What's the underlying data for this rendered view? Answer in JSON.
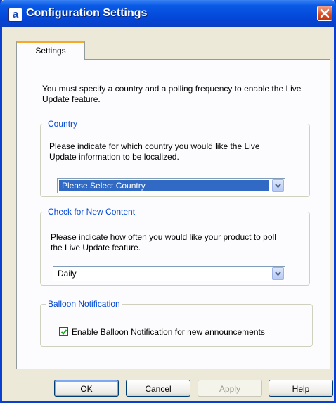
{
  "window": {
    "title": "Configuration Settings",
    "app_icon_letter": "a"
  },
  "tabs": [
    {
      "label": "Settings",
      "active": true
    }
  ],
  "intro_text": "You must specify a country and a polling frequency to enable the Live Update feature.",
  "country": {
    "legend": "Country",
    "description": "Please indicate for which country you would like the Live Update information to be localized.",
    "selected": "Please Select Country"
  },
  "content_check": {
    "legend": "Check for New Content",
    "description": "Please indicate how often you would like your product to poll the Live Update feature.",
    "selected": "Daily"
  },
  "balloon": {
    "legend": "Balloon Notification",
    "checkbox_label": "Enable Balloon Notification for new announcements",
    "checked": true
  },
  "buttons": {
    "ok": "OK",
    "cancel": "Cancel",
    "apply": "Apply",
    "help": "Help"
  },
  "colors": {
    "titlebar": "#0346d8",
    "legend": "#0046d5",
    "selection": "#316ac5",
    "tab_accent": "#f6a928"
  }
}
